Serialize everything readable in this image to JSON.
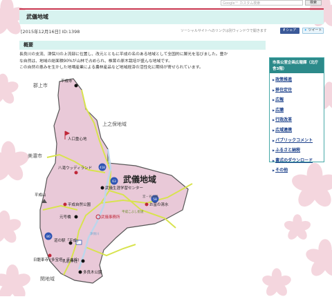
{
  "header": {
    "search_placeholder": "Google™ カスタム検索",
    "search_button": "検索"
  },
  "page": {
    "title": "武儀地域",
    "date": "[2015年12月16日]",
    "id": "ID:1398",
    "social_note": "ソーシャルサイトへのリンクは別ウィンドウで開きます",
    "share_label": "シェア",
    "tweet_label": "ツイート"
  },
  "overview": {
    "heading": "概要",
    "lines": [
      "長良川の支流、津保川の上流部に位置し、改元とともに平成の名のある地域として全国的に脚光を浴びました。豊か",
      "な自然は、地域の総面積90%が山林で占められ、椎茸の原木栽培が盛んな地域です。",
      "この自然の恵みを生かした地場産業による農林産品など地域経済の活性化に期待が寄せられています。"
    ]
  },
  "sidebar": {
    "heading": "市長公室企画広報課（北庁舎3階）",
    "items": [
      "政策推進",
      "移住定住",
      "広報",
      "広聴",
      "行政改革",
      "広域連携",
      "パブリックコメント",
      "ふるさと納税",
      "書式のダウンロード",
      "その他"
    ]
  },
  "map": {
    "region_name": "武儀地域",
    "neighbors": [
      "郡上市",
      "上之保地域",
      "美濃市",
      "関地域"
    ],
    "places": [
      "平成寺",
      "人口重心地",
      "八滝ウッディランド",
      "武儀生涯学習センター",
      "宮・谷山線",
      "お富の清水",
      "平成自然公園",
      "平成山",
      "元号橋",
      "武儀事務所",
      "道の駅「平成」",
      "日龍峯寺 (多宝塔・千本桧)",
      "乳岩神社",
      "多良木公園",
      "平成こぶし街道",
      "津保川"
    ],
    "route_numbers": [
      "418",
      "63",
      "58",
      "80"
    ],
    "colors": {
      "region": "#e9c9d8",
      "border": "#4a4a4a",
      "road": "#d8e34e",
      "river": "#bcd6ec",
      "route_marker": "#2f55b3",
      "facility_dot": "#c0283a"
    }
  }
}
